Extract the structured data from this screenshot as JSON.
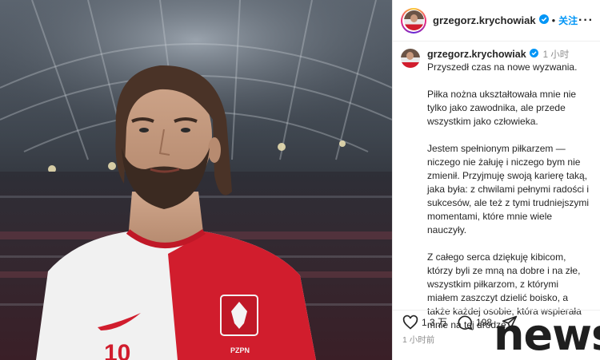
{
  "header": {
    "username": "grzegorz.krychowiak",
    "follow_label": "关注",
    "more_label": "···"
  },
  "caption": {
    "username": "grzegorz.krychowiak",
    "time": "1 小时",
    "paragraphs": [
      "Przyszedł czas na nowe wyzwania.",
      "Piłka nożna ukształtowała mnie nie tylko jako zawodnika, ale przede wszystkim jako człowieka.",
      "Jestem spełnionym piłkarzem — niczego nie żałuję i niczego bym nie zmienił. Przyjmuję swoją karierę taką, jaka była: z chwilami pełnymi radości i sukcesów, ale też z tymi trudniejszymi momentami, które mnie wiele nauczyły.",
      "Z całego serca dziękuję kibicom, którzy byli ze mną na dobre i na złe, wszystkim piłkarzom, z którymi miałem zaszczyt dzielić boisko, a także każdej osobie, która wspierała mnie na tej drodze."
    ]
  },
  "actions": {
    "likes": "1.3 万",
    "comments": "198"
  },
  "timestamp": "1 小时前",
  "watermark": "news",
  "photo": {
    "jersey_number": "10",
    "crest_text": "PZPN"
  },
  "colors": {
    "follow_blue": "#0095f6",
    "verified_blue": "#0095f6",
    "jersey_red": "#d11d2d"
  }
}
